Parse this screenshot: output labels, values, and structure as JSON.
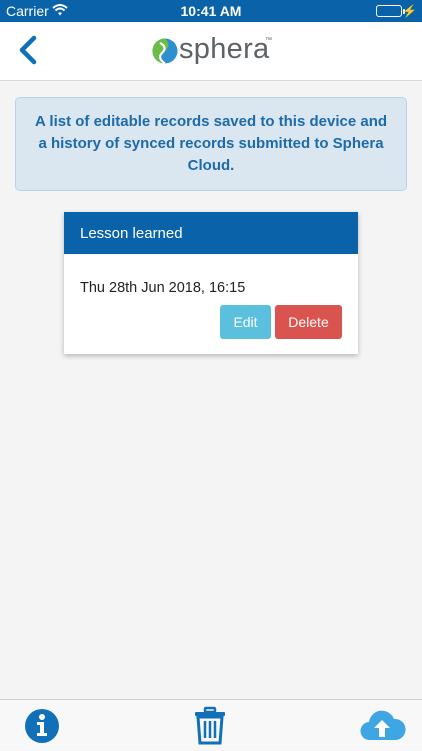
{
  "status_bar": {
    "carrier": "Carrier",
    "time": "10:41 AM",
    "battery_level": 1.0
  },
  "nav": {
    "back_icon": "chevron-left-icon",
    "logo_text": "sphera",
    "logo_tm": "™"
  },
  "banner": {
    "text": "A list of editable records saved to this device and a history of synced records submitted to Sphera Cloud."
  },
  "records": [
    {
      "title": "Lesson learned",
      "date": "Thu 28th Jun 2018, 16:15",
      "edit_label": "Edit",
      "delete_label": "Delete"
    }
  ],
  "tab_bar": {
    "items": [
      {
        "icon": "info-icon"
      },
      {
        "icon": "trash-icon"
      },
      {
        "icon": "cloud-upload-icon"
      }
    ]
  },
  "colors": {
    "brand_blue": "#0a63a8",
    "edit_button": "#5bc0de",
    "delete_button": "#d9534f",
    "banner_background": "#dae7f1",
    "banner_text": "#1f6aa8",
    "icon_blue": "#1170b8",
    "upload_icon": "#3ea6e3"
  }
}
